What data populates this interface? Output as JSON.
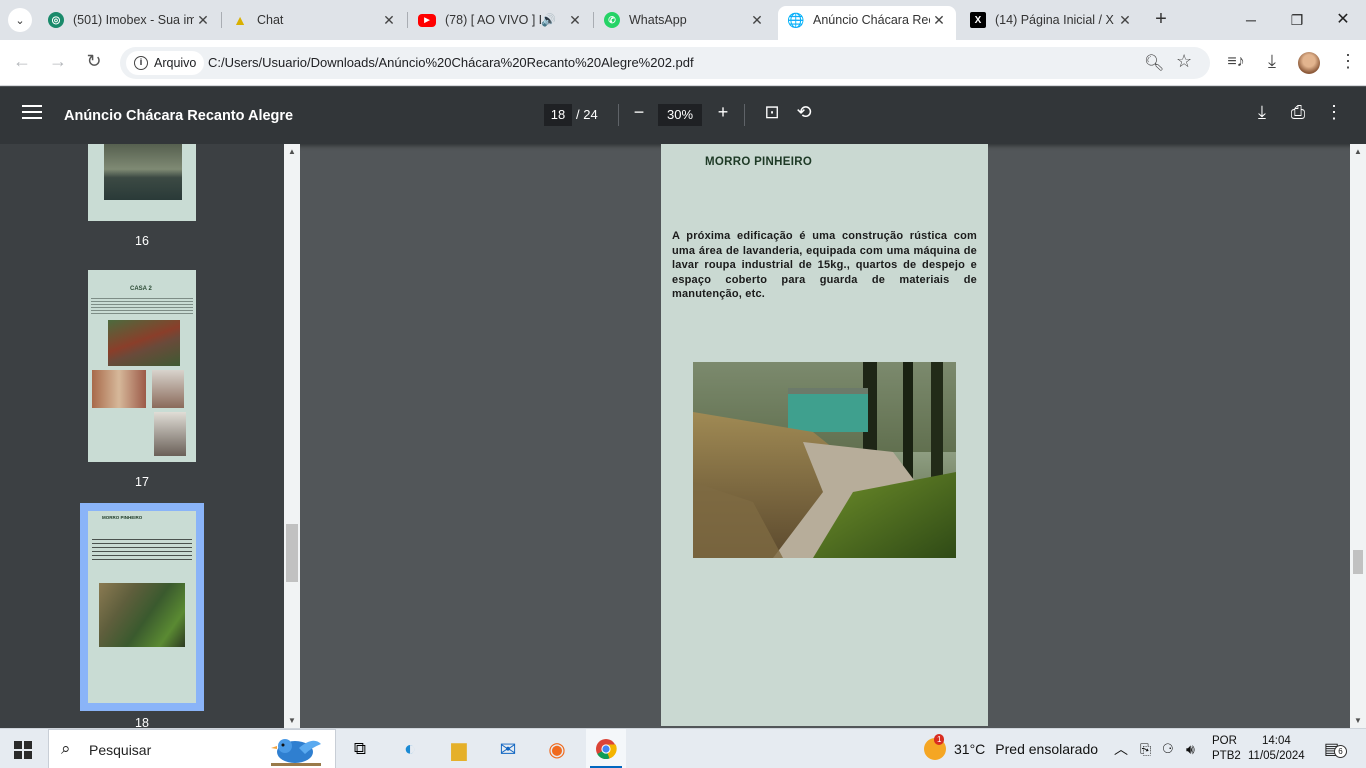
{
  "browser": {
    "tabs": [
      {
        "title": "(501) Imobex - Sua im",
        "favicon": "imobex-logo-icon",
        "color": "#1a8a6b"
      },
      {
        "title": "Chat",
        "favicon": "chat-triangle-icon",
        "color": "#f0c000"
      },
      {
        "title": "(78) [ AO VIVO ] L",
        "favicon": "youtube-icon",
        "color": "#ff0000"
      },
      {
        "title": "WhatsApp",
        "favicon": "whatsapp-icon",
        "color": "#25d366"
      },
      {
        "title": "Anúncio Chácara Rec",
        "favicon": "globe-icon",
        "color": "#5f6368"
      },
      {
        "title": "(14) Página Inicial / X",
        "favicon": "x-logo-icon",
        "color": "#000000"
      }
    ],
    "active_tab": 4,
    "address": {
      "chip_label": "Arquivo",
      "url": "C:/Users/Usuario/Downloads/Anúncio%20Chácara%20Recanto%20Alegre%202.pdf"
    }
  },
  "pdf": {
    "title": "Anúncio Chácara Recanto Alegre",
    "current_page": "18",
    "total_pages": "/ 24",
    "zoom": "30%",
    "thumbnails": [
      {
        "page": "16"
      },
      {
        "page": "17",
        "label": "CASA 2"
      },
      {
        "page": "18",
        "label": "MORRO PINHEIRO",
        "selected": true
      }
    ],
    "page_content": {
      "heading": "MORRO PINHEIRO",
      "body": "A próxima edificação é uma construção rústica com uma área de lavanderia, equipada com uma máquina de lavar roupa industrial de 15kg., quartos de despejo e espaço coberto para guarda de materiais de manutenção, etc."
    }
  },
  "taskbar": {
    "search_placeholder": "Pesquisar",
    "weather": {
      "temp": "31°C",
      "desc": "Pred ensolarado",
      "badge": "1"
    },
    "lang_top": "POR",
    "lang_bottom": "PTB2",
    "time": "14:04",
    "date": "11/05/2024",
    "notifications": "6"
  }
}
